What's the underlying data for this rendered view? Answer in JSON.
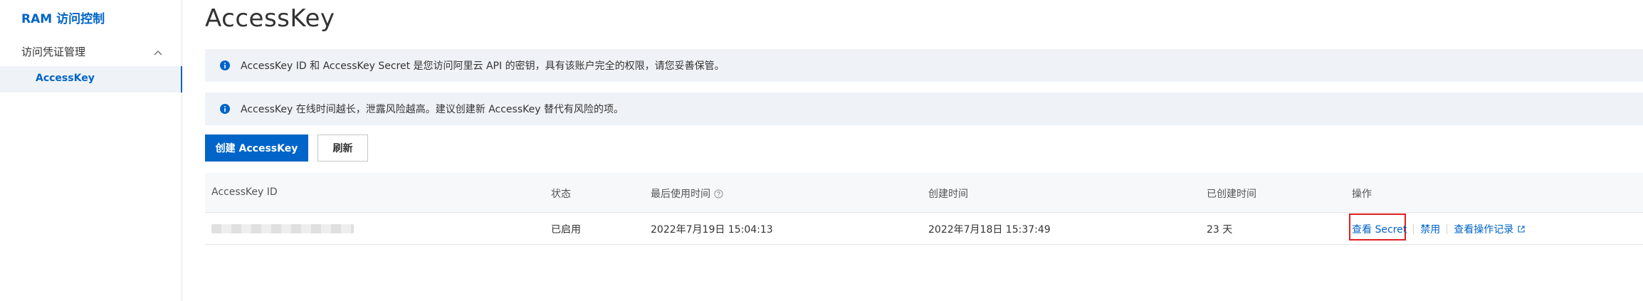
{
  "sidebar": {
    "title": "RAM 访问控制",
    "group_label": "访问凭证管理",
    "active_item": "AccessKey"
  },
  "page": {
    "title": "AccessKey"
  },
  "alerts": [
    {
      "text": "AccessKey ID 和 AccessKey Secret 是您访问阿里云 API 的密钥，具有该账户完全的权限，请您妥善保管。"
    },
    {
      "text": "AccessKey 在线时间越长，泄露风险越高。建议创建新 AccessKey 替代有风险的项。"
    }
  ],
  "toolbar": {
    "create_label": "创建 AccessKey",
    "refresh_label": "刷新"
  },
  "table": {
    "columns": [
      "AccessKey ID",
      "状态",
      "最后使用时间",
      "创建时间",
      "已创建时间",
      "操作"
    ],
    "rows": [
      {
        "status": "已启用",
        "last_used": "2022年7月19日 15:04:13",
        "created": "2022年7月18日 15:37:49",
        "age": "23 天",
        "actions": [
          "查看 Secret",
          "禁用",
          "查看操作记录"
        ]
      }
    ]
  },
  "colors": {
    "accent": "#0064c8",
    "highlight": "#e02020",
    "alert_bg": "#eff3f8"
  }
}
